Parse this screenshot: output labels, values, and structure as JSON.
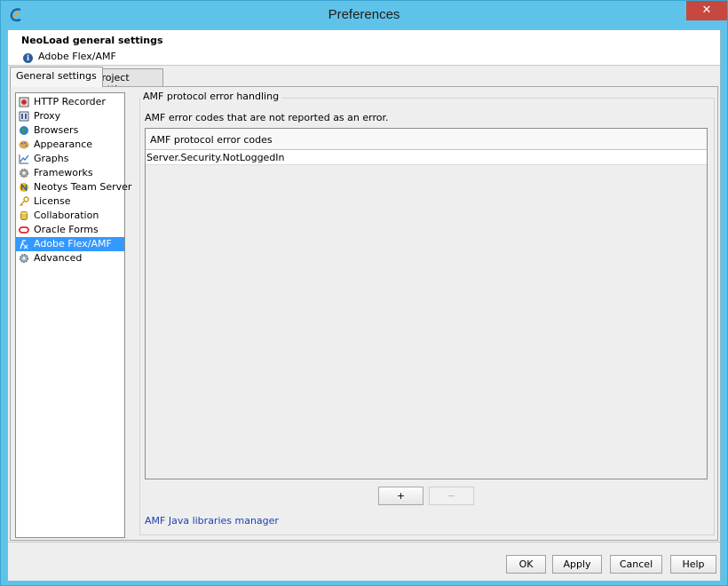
{
  "window": {
    "title": "Preferences",
    "close_glyph": "✕"
  },
  "header": {
    "title": "NeoLoad general settings",
    "subtitle": "Adobe Flex/AMF",
    "info_glyph": "i"
  },
  "tabs": [
    {
      "label": "General settings",
      "active": true
    },
    {
      "label": "Project settings",
      "active": false
    }
  ],
  "sidebar": {
    "items": [
      {
        "label": "HTTP Recorder",
        "icon": "recorder-icon"
      },
      {
        "label": "Proxy",
        "icon": "proxy-icon"
      },
      {
        "label": "Browsers",
        "icon": "globe-icon"
      },
      {
        "label": "Appearance",
        "icon": "palette-icon"
      },
      {
        "label": "Graphs",
        "icon": "graph-icon"
      },
      {
        "label": "Frameworks",
        "icon": "gear-icon"
      },
      {
        "label": "Neotys Team Server",
        "icon": "neotys-icon"
      },
      {
        "label": "License",
        "icon": "key-icon"
      },
      {
        "label": "Collaboration",
        "icon": "database-icon"
      },
      {
        "label": "Oracle Forms",
        "icon": "oracle-icon"
      },
      {
        "label": "Adobe Flex/AMF",
        "icon": "flex-icon",
        "selected": true
      },
      {
        "label": "Advanced",
        "icon": "gears-icon"
      }
    ]
  },
  "main": {
    "group_title": "AMF protocol error handling",
    "description": "AMF error codes that are not reported as an error.",
    "table": {
      "column": "AMF protocol error codes",
      "rows": [
        "Server.Security.NotLoggedIn"
      ]
    },
    "add_label": "+",
    "remove_label": "−",
    "link": "AMF Java libraries manager"
  },
  "footer": {
    "ok": "OK",
    "apply": "Apply",
    "cancel": "Cancel",
    "help": "Help"
  },
  "colors": {
    "titlebar": "#5fc3e9",
    "selection": "#3399ff",
    "close": "#c7483e",
    "link": "#1d3fb0"
  }
}
